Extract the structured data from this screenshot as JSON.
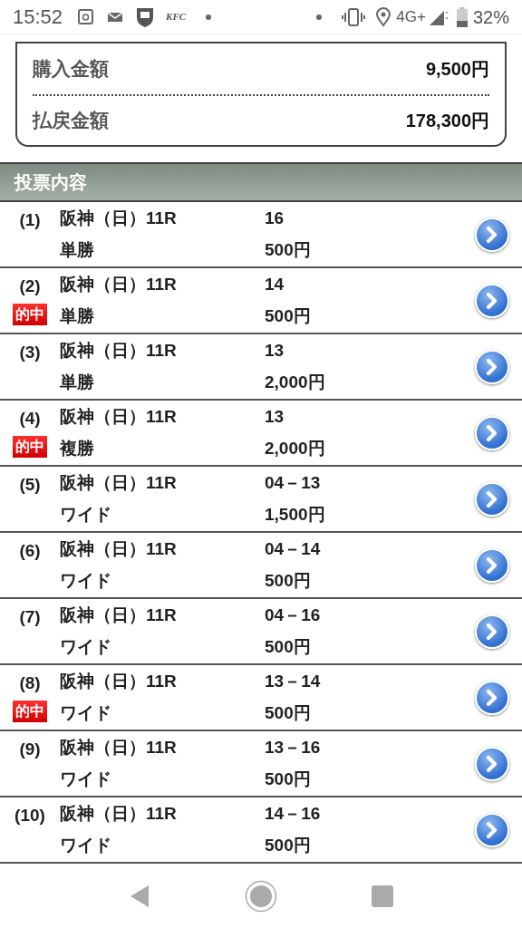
{
  "status_bar": {
    "time": "15:52",
    "logo_text": "KFC",
    "network": "4G+",
    "battery": "32%"
  },
  "summary": [
    {
      "label": "購入金額",
      "value": "9,500円"
    },
    {
      "label": "払戻金額",
      "value": "178,300円"
    }
  ],
  "section_title": "投票内容",
  "bets": [
    {
      "no": "(1)",
      "race": "阪神（日）11R",
      "type": "単勝",
      "numbers": "16",
      "amount": "500円"
    },
    {
      "no": "(2)",
      "race": "阪神（日）11R",
      "type": "単勝",
      "numbers": "14",
      "amount": "500円",
      "badge": "的中"
    },
    {
      "no": "(3)",
      "race": "阪神（日）11R",
      "type": "単勝",
      "numbers": "13",
      "amount": "2,000円"
    },
    {
      "no": "(4)",
      "race": "阪神（日）11R",
      "type": "複勝",
      "numbers": "13",
      "amount": "2,000円",
      "badge": "的中"
    },
    {
      "no": "(5)",
      "race": "阪神（日）11R",
      "type": "ワイド",
      "numbers": "04－13",
      "amount": "1,500円"
    },
    {
      "no": "(6)",
      "race": "阪神（日）11R",
      "type": "ワイド",
      "numbers": "04－14",
      "amount": "500円"
    },
    {
      "no": "(7)",
      "race": "阪神（日）11R",
      "type": "ワイド",
      "numbers": "04－16",
      "amount": "500円"
    },
    {
      "no": "(8)",
      "race": "阪神（日）11R",
      "type": "ワイド",
      "numbers": "13－14",
      "amount": "500円",
      "badge": "的中"
    },
    {
      "no": "(9)",
      "race": "阪神（日）11R",
      "type": "ワイド",
      "numbers": "13－16",
      "amount": "500円"
    },
    {
      "no": "(10)",
      "race": "阪神（日）11R",
      "type": "ワイド",
      "numbers": "14－16",
      "amount": "500円"
    }
  ]
}
